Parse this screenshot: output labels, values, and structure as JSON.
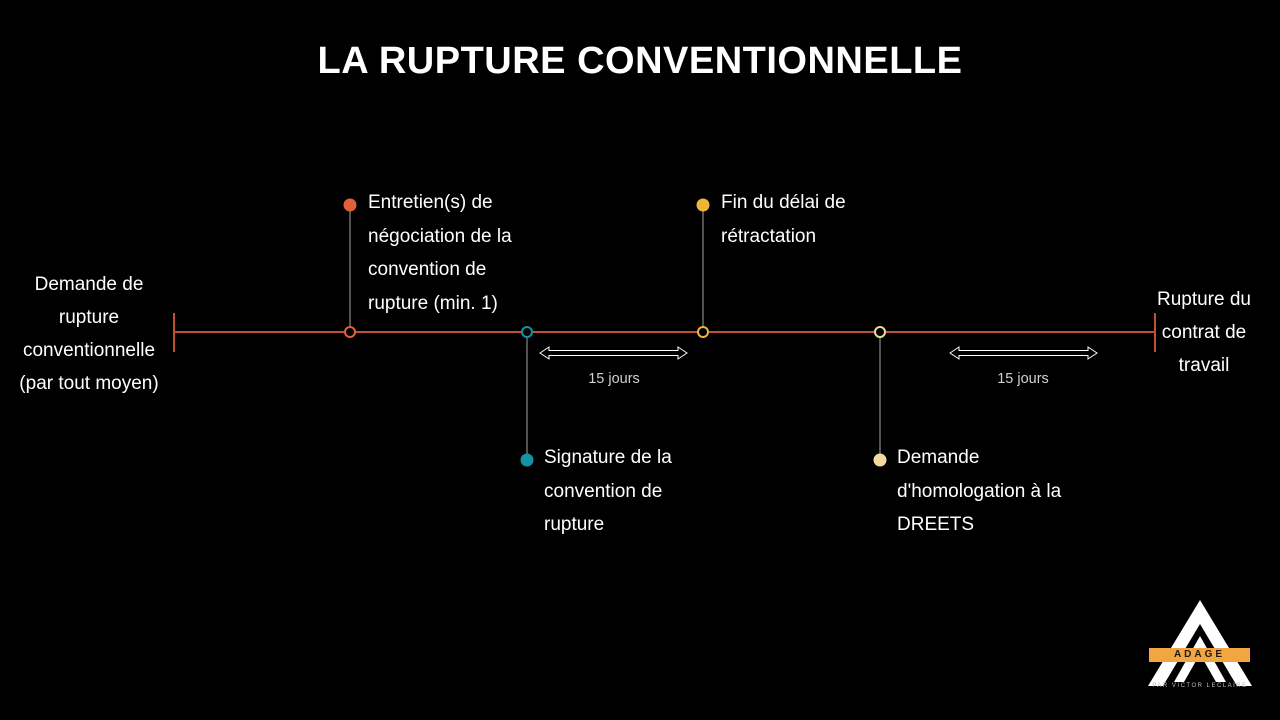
{
  "title": "LA RUPTURE CONVENTIONNELLE",
  "start_label": [
    "Demande de",
    "rupture",
    "conventionnelle",
    "(par tout moyen)"
  ],
  "end_label": [
    "Rupture du",
    "contrat de",
    "travail"
  ],
  "steps": [
    {
      "lines": [
        "Entretien(s) de",
        "négociation de la",
        "convention de",
        "rupture (min. 1)"
      ],
      "color": "#e0603a",
      "side": "above"
    },
    {
      "lines": [
        "Signature de la",
        "convention de",
        "rupture"
      ],
      "color": "#1592a3",
      "side": "below"
    },
    {
      "lines": [
        "Fin du délai de",
        "rétractation"
      ],
      "color": "#f0b43a",
      "side": "above"
    },
    {
      "lines": [
        "Demande",
        "d'homologation à la",
        "DREETS"
      ],
      "color": "#f1d9a0",
      "side": "below"
    }
  ],
  "durations": [
    "15 jours",
    "15 jours"
  ],
  "colors": {
    "timeline": "#c0502e",
    "background": "#000000",
    "connector": "#8a8a8a"
  },
  "logo": {
    "name": "ADAGE",
    "subtitle": "PAR VICTOR LECLAIRE"
  }
}
